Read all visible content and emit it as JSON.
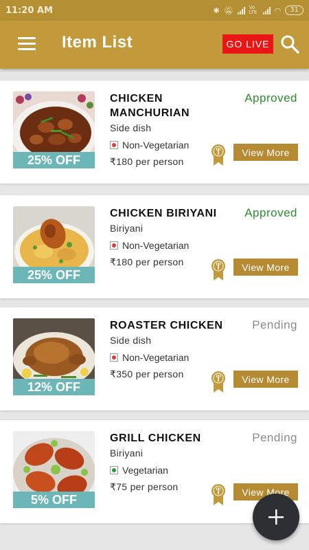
{
  "status_bar": {
    "time": "11:20 AM",
    "network_label": "Vo LTE",
    "battery": "31"
  },
  "header": {
    "title": "Item List",
    "go_live_label": "GO LIVE",
    "icons": {
      "menu": "hamburger-menu-icon",
      "search": "search-icon"
    },
    "colors": {
      "bar": "#c29a3b",
      "go_live": "#ea1515"
    }
  },
  "items": [
    {
      "name": "CHICKEN MANCHURIAN",
      "category": "Side dish",
      "diet": "Non-Vegetarian",
      "diet_color": "#e53935",
      "price": "₹180 per person",
      "discount": "25% OFF",
      "status": "Approved",
      "status_color": "#2e8b2e",
      "view_more": "View More"
    },
    {
      "name": "CHICKEN BIRIYANI",
      "category": "Biriyani",
      "diet": "Non-Vegetarian",
      "diet_color": "#e53935",
      "price": "₹180 per person",
      "discount": "25% OFF",
      "status": "Approved",
      "status_color": "#2e8b2e",
      "view_more": "View More"
    },
    {
      "name": "ROASTER CHICKEN",
      "category": "Side dish",
      "diet": "Non-Vegetarian",
      "diet_color": "#e53935",
      "price": "₹350 per person",
      "discount": "12% OFF",
      "status": "Pending",
      "status_color": "#8a8a8a",
      "view_more": "View More"
    },
    {
      "name": "GRILL CHICKEN",
      "category": "Biriyani",
      "diet": "Vegetarian",
      "diet_color": "#1e9e3a",
      "price": "₹75 per person",
      "discount": "5% OFF",
      "status": "Pending",
      "status_color": "#8a8a8a",
      "view_more": "View More"
    }
  ],
  "fab": {
    "icon": "plus-icon",
    "label": "+"
  }
}
